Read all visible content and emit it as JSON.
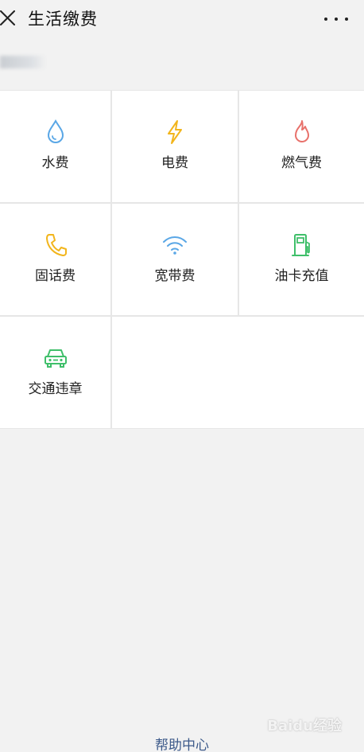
{
  "header": {
    "title": "生活缴费",
    "close_icon": "close-icon",
    "more_icon": "more-dots-icon"
  },
  "services": [
    {
      "label": "水费",
      "icon": "water-drop-icon",
      "color": "#5aa7e6"
    },
    {
      "label": "电费",
      "icon": "lightning-icon",
      "color": "#f2b51c"
    },
    {
      "label": "燃气费",
      "icon": "flame-icon",
      "color": "#e8716b"
    },
    {
      "label": "固话费",
      "icon": "phone-icon",
      "color": "#f2b51c"
    },
    {
      "label": "宽带费",
      "icon": "wifi-icon",
      "color": "#5aa7e6"
    },
    {
      "label": "油卡充值",
      "icon": "fuel-pump-icon",
      "color": "#3fbf6a"
    },
    {
      "label": "交通违章",
      "icon": "car-icon",
      "color": "#3fbf6a"
    }
  ],
  "footer": {
    "help_label": "帮助中心"
  },
  "watermark": {
    "text": "Baidu经验"
  }
}
